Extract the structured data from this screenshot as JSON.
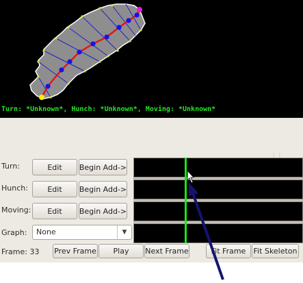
{
  "status_line": {
    "turn_label": "Turn:",
    "turn_value": "*Unknown*,",
    "hunch_label": "Hunch:",
    "hunch_value": "*Unknown*,",
    "moving_label": "Moving:",
    "moving_value": "*Unknown*",
    "color": "#22e822"
  },
  "rows": [
    {
      "label": "Turn:",
      "edit_label": "Edit",
      "begin_label": "Begin Add->"
    },
    {
      "label": "Hunch:",
      "edit_label": "Edit",
      "begin_label": "Begin Add->"
    },
    {
      "label": "Moving:",
      "edit_label": "Edit",
      "begin_label": "Begin Add->"
    }
  ],
  "graph": {
    "label": "Graph:",
    "selected": "None"
  },
  "frame": {
    "label": "Frame: 33",
    "prev_label": "Prev Frame",
    "play_label": "Play",
    "next_label": "Next Frame",
    "fit_frame_label": "Fit Frame",
    "fit_skeleton_label": "Fit Skeleton"
  },
  "colors": {
    "video_background": "#000000",
    "worm_body": "#8e8e8e",
    "skeleton": "#e61515",
    "skeleton_nodes": "#1414e6",
    "head_marker": "#ffee00",
    "tail_marker": "#e020e0",
    "frame_cursor": "#19e619",
    "annotation_arrow": "#14146e"
  }
}
